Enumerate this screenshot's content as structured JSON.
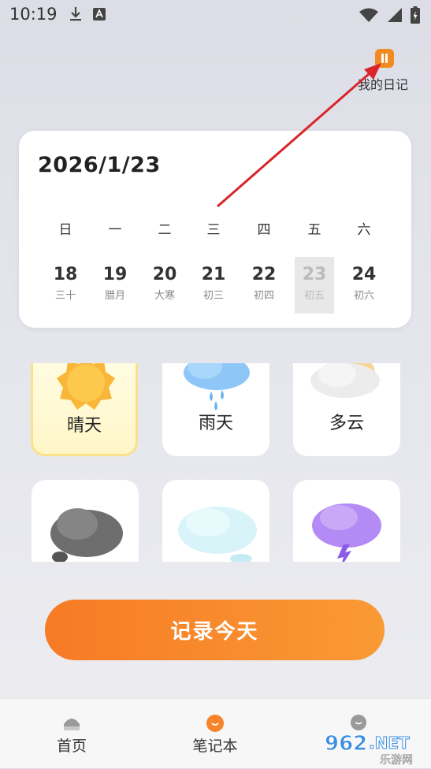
{
  "status_bar": {
    "time": "10:19"
  },
  "header": {
    "diary_label": "我的日记"
  },
  "calendar": {
    "date_title": "2026/1/23",
    "weekdays": [
      "日",
      "一",
      "二",
      "三",
      "四",
      "五",
      "六"
    ],
    "days": [
      {
        "num": "18",
        "lunar": "三十"
      },
      {
        "num": "19",
        "lunar": "腊月"
      },
      {
        "num": "20",
        "lunar": "大寒"
      },
      {
        "num": "21",
        "lunar": "初三"
      },
      {
        "num": "22",
        "lunar": "初四"
      },
      {
        "num": "23",
        "lunar": "初五"
      },
      {
        "num": "24",
        "lunar": "初六"
      }
    ],
    "selected_day": "23"
  },
  "weather": {
    "options": [
      {
        "label": "晴天",
        "icon": "sun-icon"
      },
      {
        "label": "雨天",
        "icon": "rain-cloud-icon"
      },
      {
        "label": "多云",
        "icon": "cloudy-icon"
      },
      {
        "label": "",
        "icon": "dark-cloud-icon"
      },
      {
        "label": "",
        "icon": "mist-cloud-icon"
      },
      {
        "label": "",
        "icon": "thunder-cloud-icon"
      }
    ],
    "selected": "晴天"
  },
  "record_button": {
    "label": "记录今天"
  },
  "bottom_nav": {
    "items": [
      {
        "label": "首页",
        "icon": "home-icon"
      },
      {
        "label": "笔记本",
        "icon": "notebook-icon"
      },
      {
        "label": "",
        "icon": "profile-icon"
      }
    ],
    "active": "笔记本"
  },
  "watermark": {
    "text": "962.NET",
    "sub": "乐游网"
  },
  "colors": {
    "accent": "#f7832a",
    "selected_border": "#f9e28a",
    "arrow": "#d9252b"
  }
}
